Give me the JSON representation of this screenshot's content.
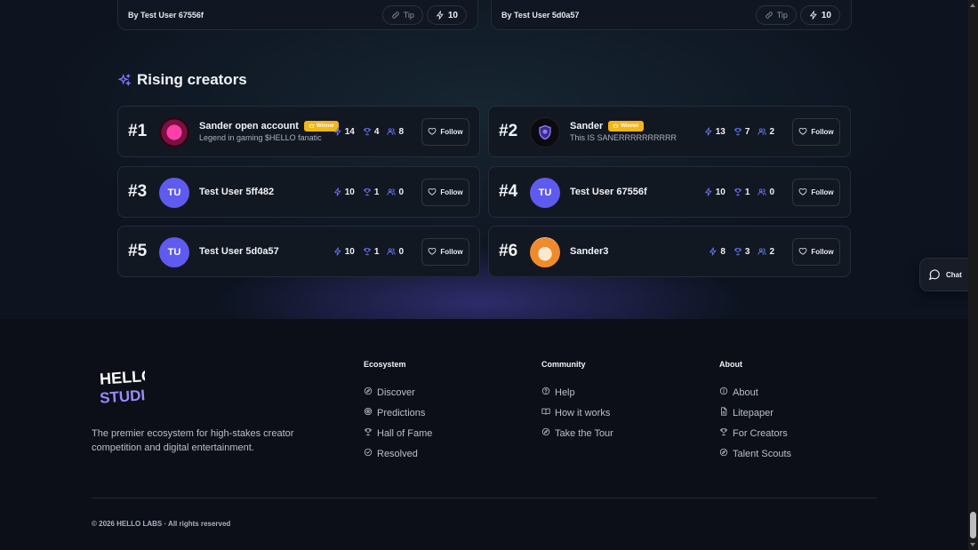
{
  "top_cards": [
    {
      "by": "By Test User 67556f",
      "tip_label": "Tip",
      "count": "10"
    },
    {
      "by": "By Test User 5d0a57",
      "tip_label": "Tip",
      "count": "10"
    }
  ],
  "rising": {
    "title": "Rising creators",
    "follow_label": "Follow",
    "winner_label": "Winner",
    "creators": [
      {
        "rank": "#1",
        "name": "Sander open account",
        "bio": "Legend in gaming $HELLO fanatic",
        "winner": true,
        "initials": "",
        "bolts": "14",
        "trophies": "4",
        "followers": "8"
      },
      {
        "rank": "#2",
        "name": "Sander",
        "bio": "This IS SANERRRRRRRRRR",
        "winner": true,
        "initials": "",
        "bolts": "13",
        "trophies": "7",
        "followers": "2"
      },
      {
        "rank": "#3",
        "name": "Test User 5ff482",
        "bio": "",
        "winner": false,
        "initials": "TU",
        "bolts": "10",
        "trophies": "1",
        "followers": "0"
      },
      {
        "rank": "#4",
        "name": "Test User 67556f",
        "bio": "",
        "winner": false,
        "initials": "TU",
        "bolts": "10",
        "trophies": "1",
        "followers": "0"
      },
      {
        "rank": "#5",
        "name": "Test User 5d0a57",
        "bio": "",
        "winner": false,
        "initials": "TU",
        "bolts": "10",
        "trophies": "1",
        "followers": "0"
      },
      {
        "rank": "#6",
        "name": "Sander3",
        "bio": "",
        "winner": false,
        "initials": "",
        "bolts": "8",
        "trophies": "3",
        "followers": "2"
      }
    ]
  },
  "footer": {
    "logo_top": "HELLO",
    "logo_bottom": "STUDIO",
    "tagline": "The premier ecosystem for high-stakes creator competition and digital entertainment.",
    "columns": [
      {
        "title": "Ecosystem",
        "links": [
          {
            "label": "Discover",
            "icon": "compass-icon"
          },
          {
            "label": "Predictions",
            "icon": "target-icon"
          },
          {
            "label": "Hall of Fame",
            "icon": "trophy-icon"
          },
          {
            "label": "Resolved",
            "icon": "check-circle-icon"
          }
        ]
      },
      {
        "title": "Community",
        "links": [
          {
            "label": "Help",
            "icon": "help-circle-icon"
          },
          {
            "label": "How it works",
            "icon": "book-icon"
          },
          {
            "label": "Take the Tour",
            "icon": "compass-icon"
          }
        ]
      },
      {
        "title": "About",
        "links": [
          {
            "label": "About",
            "icon": "info-icon"
          },
          {
            "label": "Litepaper",
            "icon": "document-icon"
          },
          {
            "label": "For Creators",
            "icon": "trophy-icon"
          },
          {
            "label": "Talent Scouts",
            "icon": "compass-icon"
          }
        ]
      }
    ],
    "copyright": "© 2026 HELLO LABS · All rights reserved"
  },
  "chat": {
    "label": "Chat"
  },
  "colors": {
    "accent": "#5f5bf0",
    "winner": "#f4b516",
    "background": "#0c0f17"
  }
}
